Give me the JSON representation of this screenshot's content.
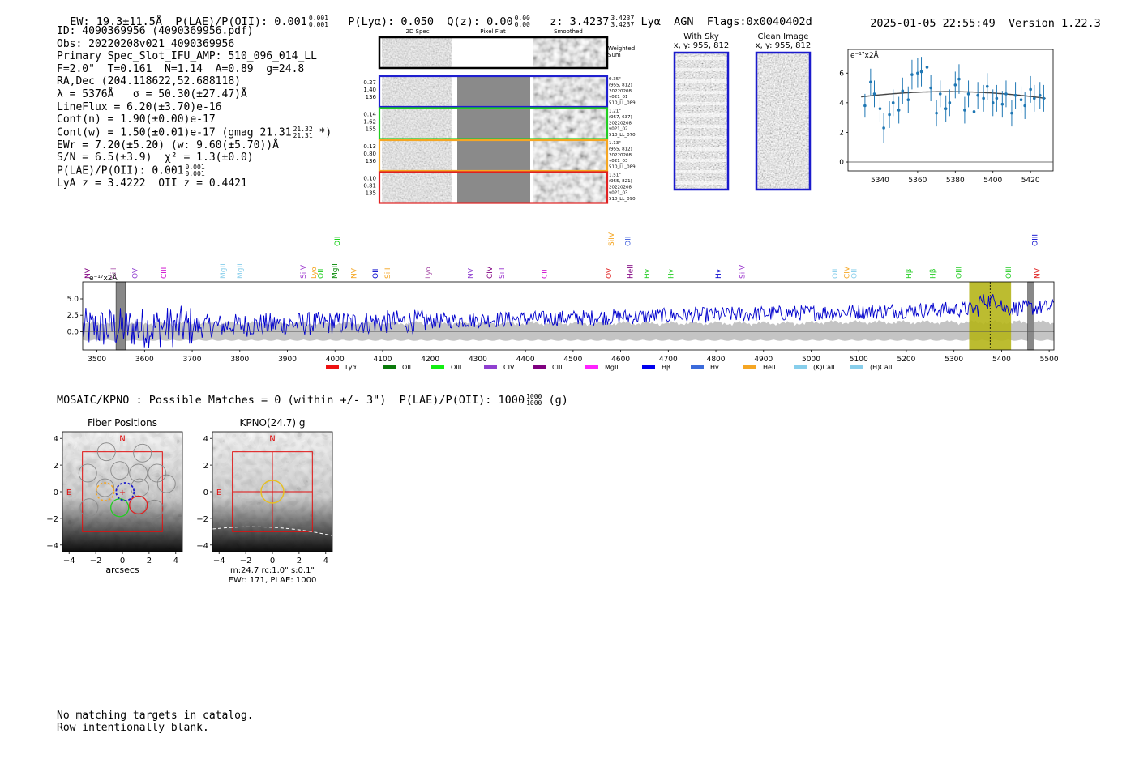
{
  "header": {
    "ew": "EW: 19.3±11.5Å",
    "plae_label": "P(LAE)/P(OII): 0.001",
    "plae_hi": "0.001",
    "plae_lo": "0.001",
    "plya": "P(Lyα): 0.050",
    "qz_label": "Q(z): 0.00",
    "qz_hi": "0.00",
    "qz_lo": "0.00",
    "z_label": "z: 3.4237",
    "z_hi": "3.4237",
    "z_lo": "3.4237",
    "line_id": "Lyα",
    "agn": "AGN",
    "flags": "Flags:0x0040402d",
    "timestamp": "2025-01-05 22:55:49",
    "version": "Version 1.22.3"
  },
  "info": {
    "id": "ID: 4090369956 (4090369956.pdf)",
    "obs": "Obs: 20220208v021_4090369956",
    "primary": "Primary Spec_Slot_IFU_AMP: 510_096_014_LL",
    "params": "F=2.0\"  T=0.161  N=1.14  A=0.89  g=24.8",
    "radec": "RA,Dec (204.118622,52.688118)",
    "lambda": "λ = 5376Å   σ = 50.30(±27.47)Å",
    "lineflux": "LineFlux = 6.20(±3.70)e-16",
    "contn": "Cont(n) = 1.90(±0.00)e-17",
    "contw": "Cont(w) = 1.50(±0.01)e-17 (gmag 21.31",
    "gmag_hi": "21.32",
    "gmag_lo": "21.31",
    "contw_end": " *)",
    "ewr": "EWr = 7.20(±5.20) (w: 9.60(±5.70))Å",
    "sn": "S/N = 6.5(±3.9)  χ² = 1.3(±0.0)",
    "plae": "P(LAE)/P(OII): 0.001",
    "plae_hi": "0.001",
    "plae_lo": "0.001",
    "lyaz": "LyA z = 3.4222  OII z = 0.4421"
  },
  "cutouts": {
    "col_2d": "2D Spec",
    "col_flat": "Pixel Flat",
    "col_smooth": "Smoothed",
    "weighted": [
      "Weighted",
      "Sum"
    ],
    "rows": [
      {
        "left": [
          "0.27",
          "1.40",
          "136"
        ],
        "right": [
          "0.35\"",
          "(955, 812)",
          "20220208",
          "v021_01",
          "510_LL_089"
        ],
        "color": "#1f1fcf"
      },
      {
        "left": [
          "0.14",
          "1.62",
          "155"
        ],
        "right": [
          "1.21\"",
          "(957, 637)",
          "20220208",
          "v021_02",
          "510_LL_070"
        ],
        "color": "#22cc22"
      },
      {
        "left": [
          "0.13",
          "0.80",
          "136"
        ],
        "right": [
          "1.13\"",
          "(955, 812)",
          "20220208",
          "v021_03",
          "510_LL_089"
        ],
        "color": "#f5a623"
      },
      {
        "left": [
          "0.10",
          "0.81",
          "135"
        ],
        "right": [
          "1.51\"",
          "(955, 821)",
          "20220208",
          "v021_03",
          "510_LL_090"
        ],
        "color": "#e02020"
      }
    ]
  },
  "sky": {
    "with_sky_title": "With Sky",
    "with_sky_xy": "x, y: 955, 812",
    "clean_title": "Clean Image",
    "clean_xy": "x, y: 955, 812"
  },
  "chart_data": [
    {
      "type": "scatter",
      "title": "",
      "unit_label": "e⁻¹⁷x2Å",
      "x": [
        5332,
        5335,
        5337,
        5340,
        5342,
        5345,
        5347,
        5350,
        5352,
        5355,
        5357,
        5360,
        5362,
        5365,
        5367,
        5370,
        5372,
        5375,
        5377,
        5380,
        5382,
        5385,
        5387,
        5390,
        5392,
        5395,
        5397,
        5400,
        5402,
        5405,
        5407,
        5410,
        5412,
        5415,
        5417,
        5420,
        5422,
        5425,
        5427
      ],
      "y": [
        3.8,
        5.4,
        4.6,
        3.6,
        2.3,
        3.2,
        4.0,
        3.5,
        4.8,
        4.2,
        5.9,
        6.0,
        6.1,
        6.4,
        5.0,
        3.3,
        4.6,
        3.6,
        4.0,
        5.2,
        5.6,
        3.5,
        4.6,
        3.4,
        4.5,
        4.3,
        5.1,
        4.0,
        4.3,
        3.9,
        4.6,
        3.3,
        4.5,
        4.2,
        3.8,
        4.9,
        4.3,
        4.5,
        4.3
      ],
      "err": [
        0.8,
        0.9,
        0.9,
        0.9,
        1.0,
        0.9,
        0.9,
        0.9,
        0.9,
        0.9,
        1.0,
        1.0,
        1.0,
        1.0,
        0.9,
        0.9,
        0.9,
        0.9,
        0.9,
        0.9,
        1.0,
        0.9,
        0.9,
        0.9,
        0.9,
        0.9,
        0.9,
        0.9,
        0.9,
        0.9,
        0.9,
        0.9,
        0.9,
        0.9,
        0.9,
        0.9,
        0.9,
        0.9,
        0.9
      ],
      "fit": {
        "amp": 4.75,
        "center": 5376,
        "sigma": 50.3
      },
      "xlim": [
        5323,
        5432
      ],
      "ylim": [
        -0.6,
        7.6
      ],
      "xticks": [
        5340,
        5360,
        5380,
        5400,
        5420
      ],
      "yticks": [
        0,
        2,
        4,
        6
      ],
      "marker_color": "#1f77b4"
    },
    {
      "type": "line",
      "title": "",
      "unit_label": "e⁻¹⁷x2Å",
      "xlim": [
        3470,
        5510
      ],
      "ylim": [
        -2.8,
        7.6
      ],
      "xticks": [
        3500,
        3600,
        3700,
        3800,
        3900,
        4000,
        4100,
        4200,
        4300,
        4400,
        4500,
        4600,
        4700,
        4800,
        4900,
        5000,
        5100,
        5200,
        5300,
        5400,
        5500
      ],
      "yticks": [
        0.0,
        2.5,
        5.0
      ],
      "line_color": "#0000cc",
      "highlight_window": [
        5332,
        5420
      ],
      "center_wavelength": 5376,
      "masked_regions": [
        [
          3540,
          3560
        ],
        [
          5455,
          5468
        ]
      ],
      "line_markers": [
        {
          "name": "NV",
          "lam": 3480,
          "color": "#800080",
          "row": 3
        },
        {
          "name": "SiII",
          "lam": 3535,
          "color": "#b05fb0",
          "row": 3
        },
        {
          "name": "OVI",
          "lam": 3580,
          "color": "#9040d0",
          "row": 3
        },
        {
          "name": "CIII",
          "lam": 3640,
          "color": "#cc00cc",
          "row": 3
        },
        {
          "name": "MgII",
          "lam": 3765,
          "color": "#87ceeb",
          "row": 3
        },
        {
          "name": "MgII",
          "lam": 3800,
          "color": "#87ceeb",
          "row": 3
        },
        {
          "name": "SiIV",
          "lam": 3933,
          "color": "#9932cc",
          "row": 3
        },
        {
          "name": "Lyα",
          "lam": 3955,
          "color": "#f5a623",
          "row": 3
        },
        {
          "name": "OII",
          "lam": 3970,
          "color": "#22cc22",
          "row": 3
        },
        {
          "name": "MgII",
          "lam": 4000,
          "color": "#008800",
          "row": 3
        },
        {
          "name": "OII",
          "lam": 4005,
          "color": "#00cc00",
          "row": 1
        },
        {
          "name": "NV",
          "lam": 4040,
          "color": "#f5a623",
          "row": 3
        },
        {
          "name": "OII",
          "lam": 4085,
          "color": "#0000cc",
          "row": 3
        },
        {
          "name": "SiII",
          "lam": 4110,
          "color": "#f5a623",
          "row": 3
        },
        {
          "name": "Lyα",
          "lam": 4195,
          "color": "#b05fb0",
          "row": 3
        },
        {
          "name": "NV",
          "lam": 4285,
          "color": "#9040d0",
          "row": 3
        },
        {
          "name": "CIV",
          "lam": 4325,
          "color": "#800080",
          "row": 3
        },
        {
          "name": "SiII",
          "lam": 4350,
          "color": "#9932cc",
          "row": 3
        },
        {
          "name": "CII",
          "lam": 4440,
          "color": "#cc00cc",
          "row": 3
        },
        {
          "name": "SiIV",
          "lam": 4580,
          "color": "#f5a623",
          "row": 1
        },
        {
          "name": "OII",
          "lam": 4615,
          "color": "#3b5bdb",
          "row": 1
        },
        {
          "name": "OVI",
          "lam": 4575,
          "color": "#e02020",
          "row": 3
        },
        {
          "name": "HeII",
          "lam": 4620,
          "color": "#800080",
          "row": 3
        },
        {
          "name": "Hγ",
          "lam": 4655,
          "color": "#22cc22",
          "row": 3
        },
        {
          "name": "Hγ",
          "lam": 4705,
          "color": "#22cc22",
          "row": 3
        },
        {
          "name": "Hγ",
          "lam": 4805,
          "color": "#0000cc",
          "row": 3
        },
        {
          "name": "SiIV",
          "lam": 4855,
          "color": "#9932cc",
          "row": 3
        },
        {
          "name": "OII",
          "lam": 5050,
          "color": "#87ceeb",
          "row": 3
        },
        {
          "name": "CIV",
          "lam": 5075,
          "color": "#f5a623",
          "row": 3
        },
        {
          "name": "OII",
          "lam": 5090,
          "color": "#87ceeb",
          "row": 3
        },
        {
          "name": "Hβ",
          "lam": 5205,
          "color": "#22cc22",
          "row": 3
        },
        {
          "name": "Hβ",
          "lam": 5255,
          "color": "#22cc22",
          "row": 3
        },
        {
          "name": "OIII",
          "lam": 5310,
          "color": "#22cc22",
          "row": 3
        },
        {
          "name": "OIII",
          "lam": 5415,
          "color": "#22cc22",
          "row": 3
        },
        {
          "name": "NV",
          "lam": 5475,
          "color": "#e02020",
          "row": 3
        },
        {
          "name": "OIII",
          "lam": 5470,
          "color": "#0000cc",
          "row": 1
        }
      ],
      "legend": [
        {
          "label": "Lyα",
          "color": "#ee1111"
        },
        {
          "label": "OII",
          "color": "#0a7a0a"
        },
        {
          "label": "OIII",
          "color": "#11ee11"
        },
        {
          "label": "CIV",
          "color": "#9040d0"
        },
        {
          "label": "CIII",
          "color": "#800080"
        },
        {
          "label": "MgII",
          "color": "#ff22ff"
        },
        {
          "label": "Hβ",
          "color": "#0000ee"
        },
        {
          "label": "Hγ",
          "color": "#3b6bdb"
        },
        {
          "label": "HeII",
          "color": "#f5a623"
        },
        {
          "label": "(K)CaII",
          "color": "#87ceeb"
        },
        {
          "label": "(H)CaII",
          "color": "#87ceeb"
        }
      ]
    }
  ],
  "mosaic": {
    "line": "MOSAIC/KPNO : Possible Matches = 0 (within +/- 3\")  P(LAE)/P(OII): 1000",
    "hi": "1000",
    "lo": "1000",
    "end": " (g)"
  },
  "fiber_panel": {
    "title": "Fiber Positions",
    "xlabel": "arcsecs",
    "ticks": [
      -4,
      -2,
      0,
      2,
      4
    ],
    "n_label": "N",
    "e_label": "E"
  },
  "kpno_panel": {
    "title": "KPNO(24.7) g",
    "ticks": [
      -4,
      -2,
      0,
      2,
      4
    ],
    "n_label": "N",
    "e_label": "E",
    "caption1": "m:24.7 rc:1.0\"  s:0.1\"",
    "caption2": "EWr: 171, PLAE: 1000"
  },
  "footer": {
    "line1": "No matching targets in catalog.",
    "line2": "Row intentionally blank."
  }
}
